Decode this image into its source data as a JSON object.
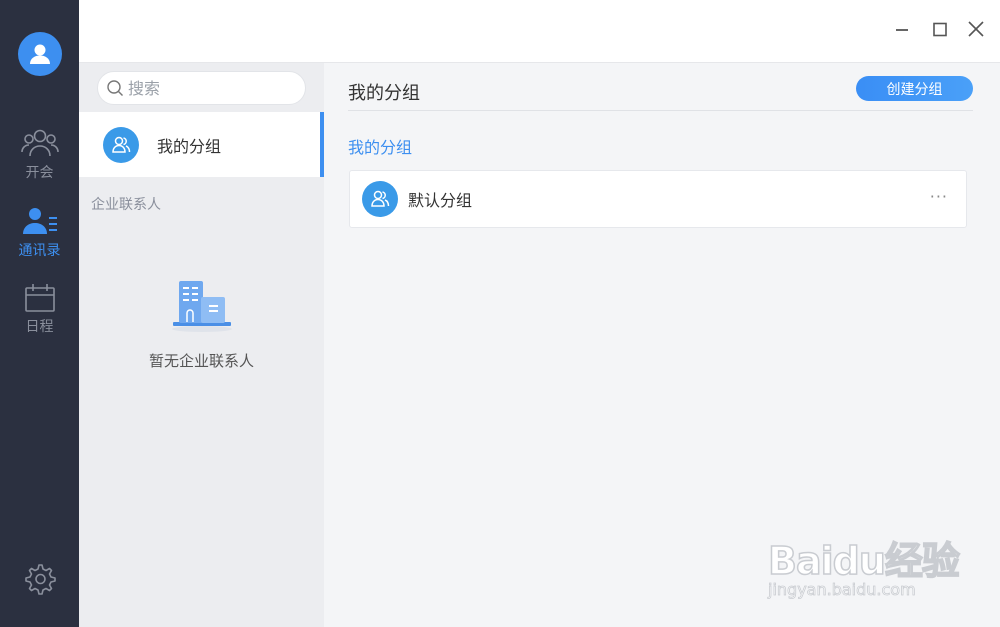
{
  "window": {
    "minimize_icon": "minimize-icon",
    "maximize_icon": "maximize-icon",
    "close_icon": "close-icon"
  },
  "rail": {
    "avatar_icon": "user-avatar-icon",
    "items": [
      {
        "label": "开会",
        "icon": "people-icon",
        "active": false
      },
      {
        "label": "通讯录",
        "icon": "contacts-icon",
        "active": true
      },
      {
        "label": "日程",
        "icon": "calendar-icon",
        "active": false
      }
    ],
    "settings_icon": "gear-icon"
  },
  "sidebar": {
    "search_placeholder": "搜索",
    "group_item": "我的分组",
    "section_label": "企业联系人",
    "empty_text": "暂无企业联系人"
  },
  "content": {
    "title": "我的分组",
    "create_button": "创建分组",
    "subtitle": "我的分组",
    "groups": [
      {
        "name": "默认分组",
        "more": "···"
      }
    ]
  },
  "watermark": {
    "brand": "Baidu经验",
    "url": "jingyan.baidu.com"
  },
  "colors": {
    "accent": "#3d8ff0",
    "rail_bg": "#2b3040"
  }
}
